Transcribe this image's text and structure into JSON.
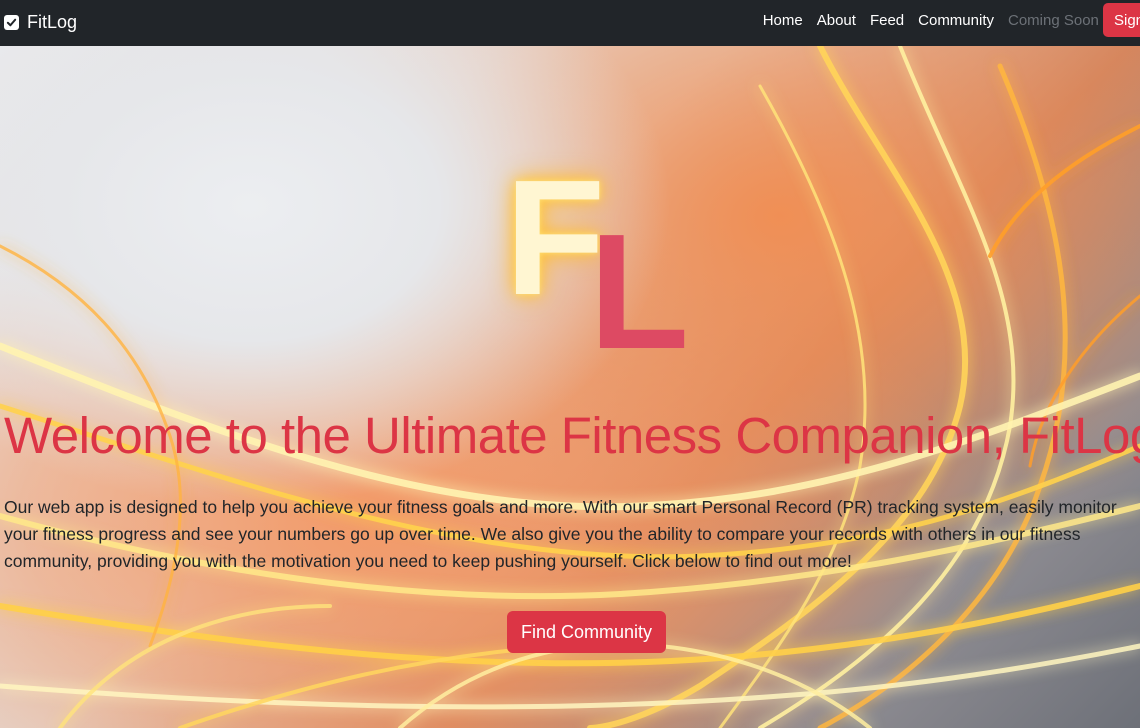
{
  "navbar": {
    "brand": "FitLog",
    "brand_icon": "checkbox-icon",
    "links": [
      "Home",
      "About",
      "Feed",
      "Community"
    ],
    "coming_soon": "Coming Soon",
    "signup_label": "Sign"
  },
  "hero": {
    "logo": {
      "f": "F",
      "l": "L"
    },
    "headline": "Welcome to the Ultimate Fitness Companion, FitLog!",
    "intro": "Our web app is designed to help you achieve your fitness goals and more. With our smart Personal Record (PR) tracking system, easily monitor your fitness progress and see your numbers go up over time. We also give you the ability to compare your records with others in our fitness community, providing you with the motivation you need to keep pushing yourself. Click below to find out more!",
    "cta_label": "Find Community"
  },
  "colors": {
    "navbar_bg": "#212529",
    "accent": "#dc3545",
    "text": "#212529",
    "logo_f": "#fff6d2",
    "logo_l": "#dd4a63"
  }
}
